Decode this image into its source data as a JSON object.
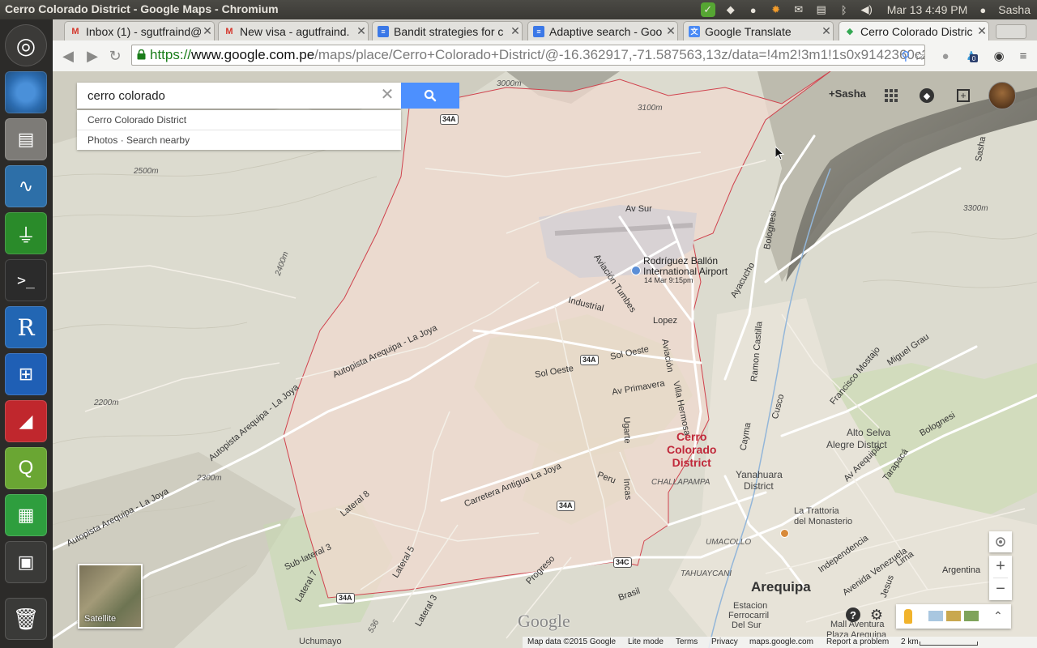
{
  "os": {
    "window_title": "Cerro Colorado District - Google Maps - Chromium",
    "clock": "Mar 13  4:49 PM",
    "user": "Sasha",
    "launcher_icons": [
      "ubuntu-dash-icon",
      "chromium-icon",
      "file-manager-icon",
      "system-monitor-icon",
      "network-icon",
      "terminal-icon",
      "r-icon",
      "calculator-icon",
      "presentation-icon",
      "qgis-icon",
      "spreadsheet-icon",
      "workspace-switcher-icon",
      "trash-icon"
    ]
  },
  "tabs": [
    {
      "label": "Inbox (1) - sgutfraind@",
      "icon": "gmail-icon"
    },
    {
      "label": "New visa - agutfraind.",
      "icon": "gmail-icon"
    },
    {
      "label": "Bandit strategies for c",
      "icon": "docs-icon"
    },
    {
      "label": "Adaptive search - Goo",
      "icon": "docs-icon"
    },
    {
      "label": "Google Translate",
      "icon": "translate-icon"
    },
    {
      "label": "Cerro Colorado Distric",
      "icon": "maps-icon",
      "active": true
    }
  ],
  "address": {
    "scheme": "https://",
    "host": "www.google.com.pe",
    "path": "/maps/place/Cerro+Colorado+District/@-16.362917,-71.587563,13z/data=!4m2!3m1!1s0x9142360c2"
  },
  "search": {
    "value": "cerro colorado",
    "suggestion_title": "Cerro Colorado District",
    "suggestion_actions": "Photos · Search nearby"
  },
  "account": {
    "name": "+Sasha",
    "badge": "0"
  },
  "map": {
    "district_name_lines": [
      "Cerro",
      "Colorado",
      "District"
    ],
    "city": "Arequipa",
    "labels": {
      "airport": "Rodríguez Ballón",
      "airport2": "International Airport",
      "airport_time": "14 Mar 9:15pm",
      "av_sur": "Av Sur",
      "industrial": "Industrial",
      "aviacion_tumbes": "Aviación Tumbes",
      "lopez": "Lopez",
      "aviacion": "Aviación",
      "sol_oeste": "Sol Oeste",
      "sol_oeste2": "Sol Oeste",
      "av_primavera": "Av Primavera",
      "villa_hermosa": "Villa Hermosa",
      "ugarte": "Ugarte",
      "peru": "Peru",
      "incas": "Incas",
      "challapampa": "CHALLAPAMPA",
      "carretera": "Carretera Antigua La Joya",
      "autopista1": "Autopista Arequipa - La Joya",
      "autopista2": "Autopista Arequipa - La Joya",
      "autopista3": "Autopista Arequipa - La Joya",
      "lateral8": "Lateral 8",
      "lateral5": "Lateral 5",
      "lateral3": "Lateral 3",
      "lateral7": "Lateral 7",
      "sublateral3": "Sub-lateral 3",
      "bolognesi": "Bolognesi",
      "bolognesi2": "Bolognesi",
      "ayacucho": "Ayacucho",
      "ramon_castilla": "Ramon Castilla",
      "cusco": "Cusco",
      "cayma": "Cayma",
      "yanahuara": "Yanahuara",
      "yanahuara2": "District",
      "alto_selva": "Alto Selva",
      "alto_selva2": "Alegre District",
      "francisco": "Francisco Mostajo",
      "miguel_grau": "Miguel Grau",
      "sasha": "Sasha",
      "trattoria": "La Trattoria",
      "trattoria2": "del Monasterio",
      "umacollo": "UMACOLLO",
      "tahuaycani": "TAHUAYCANI",
      "av_arequipa": "Av Arequipa",
      "tarapaca": "Tarapacá",
      "independencia": "Independencia",
      "avenida_venezuela": "Avenida Venezuela",
      "lima": "Lima",
      "jesus": "Jesus",
      "argentina": "Argentina",
      "estacion": "Estacion",
      "estacion2": "Ferrocarril",
      "estacion3": "Del Sur",
      "mall": "Mall Aventura",
      "mall2": "Plaza Arequipa",
      "progreso": "Progreso",
      "brasil": "Brasil",
      "uchumayo": "Uchumayo",
      "elev1": "2200m",
      "elev2": "2300m",
      "elev3": "2400m",
      "elev4": "2500m",
      "elev5": "3000m",
      "elev6": "3100m",
      "elev7": "3300m",
      "elev8": "536",
      "r34a_1": "34A",
      "r34a_2": "34A",
      "r34a_3": "34A",
      "r34a_4": "34A",
      "r34c": "34C"
    },
    "satellite_label": "Satellite",
    "logo": "Google",
    "footer": {
      "mapdata": "Map data ©2015 Google",
      "lite": "Lite mode",
      "terms": "Terms",
      "privacy": "Privacy",
      "site": "maps.google.com",
      "report": "Report a problem",
      "scale": "2 km"
    },
    "zoom_in": "+",
    "zoom_out": "−"
  },
  "colors": {
    "district_fill": "#f0d9cf",
    "district_border": "#d0424d",
    "terrain": "#dcdbcf",
    "green": "#c7d8b0",
    "search_button": "#4d90fe"
  }
}
